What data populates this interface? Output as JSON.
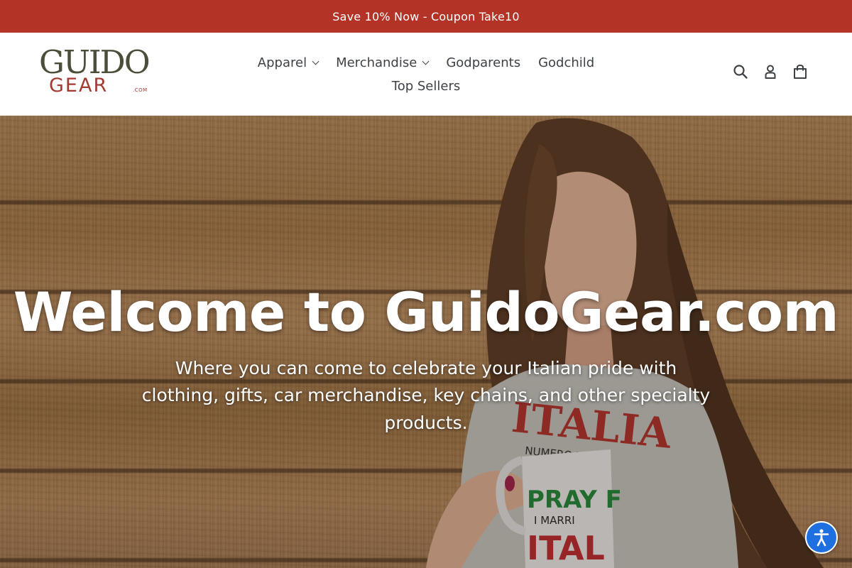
{
  "announcement": {
    "text": "Save 10% Now - Coupon Take10"
  },
  "logo": {
    "line1": "GUIDO",
    "line2": "GEAR",
    "suffix": ".COM"
  },
  "nav": {
    "items": [
      {
        "label": "Apparel",
        "has_dropdown": true
      },
      {
        "label": "Merchandise",
        "has_dropdown": true
      },
      {
        "label": "Godparents",
        "has_dropdown": false
      },
      {
        "label": "Godchild",
        "has_dropdown": false
      },
      {
        "label": "Top Sellers",
        "has_dropdown": false
      }
    ]
  },
  "header_icons": [
    "search-icon",
    "account-icon",
    "cart-icon"
  ],
  "hero": {
    "title": "Welcome to GuidoGear.com",
    "subtitle": "Where you can come to celebrate your Italian pride with clothing, gifts, car merchandise, key chains, and other specialty products.",
    "shirt_text": "ITALIA",
    "shirt_subtext": "NUMERO UNO",
    "mug_text_1": "PRAY F",
    "mug_text_2": "I MARRI",
    "mug_text_3": "ITAL"
  },
  "colors": {
    "announcement_bg": "#b33326",
    "nav_text": "#3d4246",
    "accessibility_bg": "#1e6fe0"
  },
  "accessibility": {
    "icon": "accessibility-icon"
  }
}
